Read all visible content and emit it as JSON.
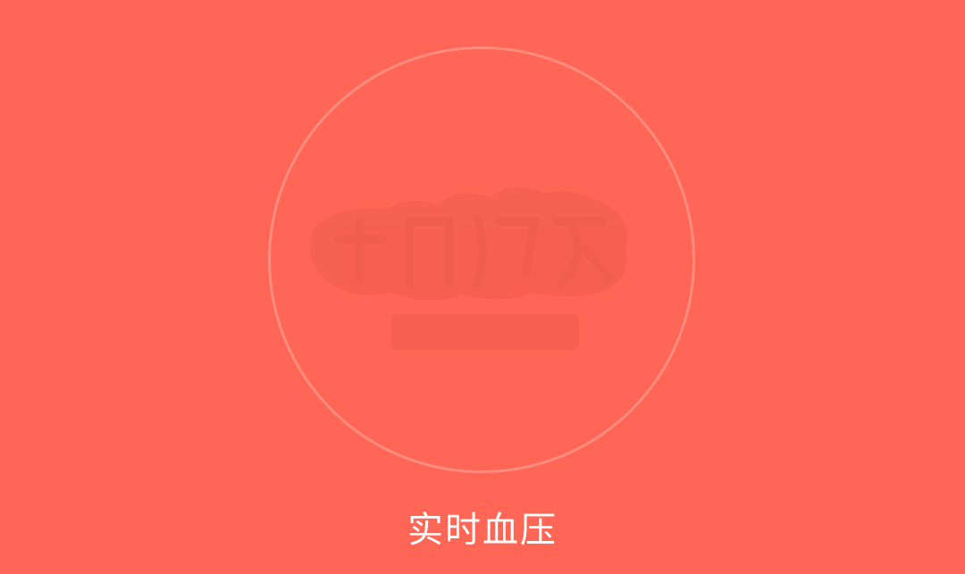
{
  "screen": {
    "background_color": "#FF6655",
    "ring_color": "rgba(255,255,255,0.25)",
    "watermark_icon": "watermark-logo",
    "caption": "实时血压"
  }
}
